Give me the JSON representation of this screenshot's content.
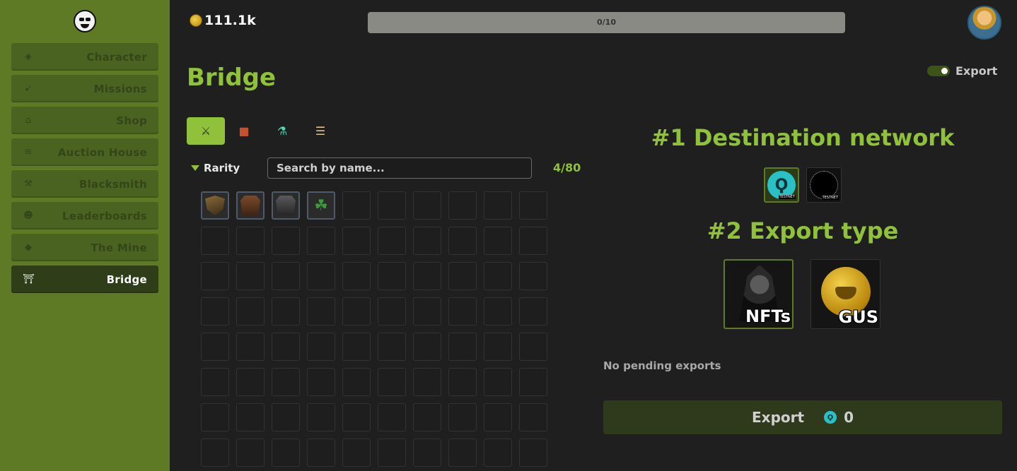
{
  "header": {
    "balance": "111.1k",
    "progress_text": "0/10",
    "progress_fraction": 0
  },
  "sidebar": {
    "items": [
      {
        "label": "Character",
        "icon": "shield-icon"
      },
      {
        "label": "Missions",
        "icon": "mission-icon"
      },
      {
        "label": "Shop",
        "icon": "shop-icon"
      },
      {
        "label": "Auction House",
        "icon": "coins-icon"
      },
      {
        "label": "Blacksmith",
        "icon": "hammer-icon"
      },
      {
        "label": "Leaderboards",
        "icon": "users-icon"
      },
      {
        "label": "The Mine",
        "icon": "gem-icon"
      },
      {
        "label": "Bridge",
        "icon": "bridge-icon",
        "active": true
      }
    ]
  },
  "page": {
    "title": "Bridge",
    "toggle_label": "Export",
    "toggle_on": true
  },
  "filters": {
    "rarity_label": "Rarity",
    "search_placeholder": "Search by name...",
    "count": "4/80",
    "tabs": [
      {
        "icon": "crossed-swords-icon",
        "active": true
      },
      {
        "icon": "ore-icon"
      },
      {
        "icon": "potion-icon"
      },
      {
        "icon": "scroll-icon"
      }
    ]
  },
  "inventory": {
    "slots_per_row": 10,
    "rows": 8,
    "items": [
      {
        "icon": "shield-icon"
      },
      {
        "icon": "leather-armor-icon"
      },
      {
        "icon": "plate-armor-icon"
      },
      {
        "icon": "clover-icon"
      }
    ]
  },
  "export_panel": {
    "network_title": "#1 Destination network",
    "networks": [
      {
        "icon": "testnet-network-icon",
        "tag": "TESTNET",
        "selected": true
      },
      {
        "icon": "iota-testnet-icon",
        "tag": "TESTNET"
      }
    ],
    "type_title": "#2 Export type",
    "types": [
      {
        "label": "NFTs",
        "icon": "hooded-knight-icon",
        "selected": true
      },
      {
        "label": "GUS",
        "icon": "orc-coin-icon"
      }
    ],
    "pending_text": "No pending exports",
    "button_label": "Export",
    "button_amount": "0"
  },
  "colors": {
    "accent": "#8fc23a",
    "sidebar": "#5e7a25",
    "background": "#1f1f1f"
  }
}
